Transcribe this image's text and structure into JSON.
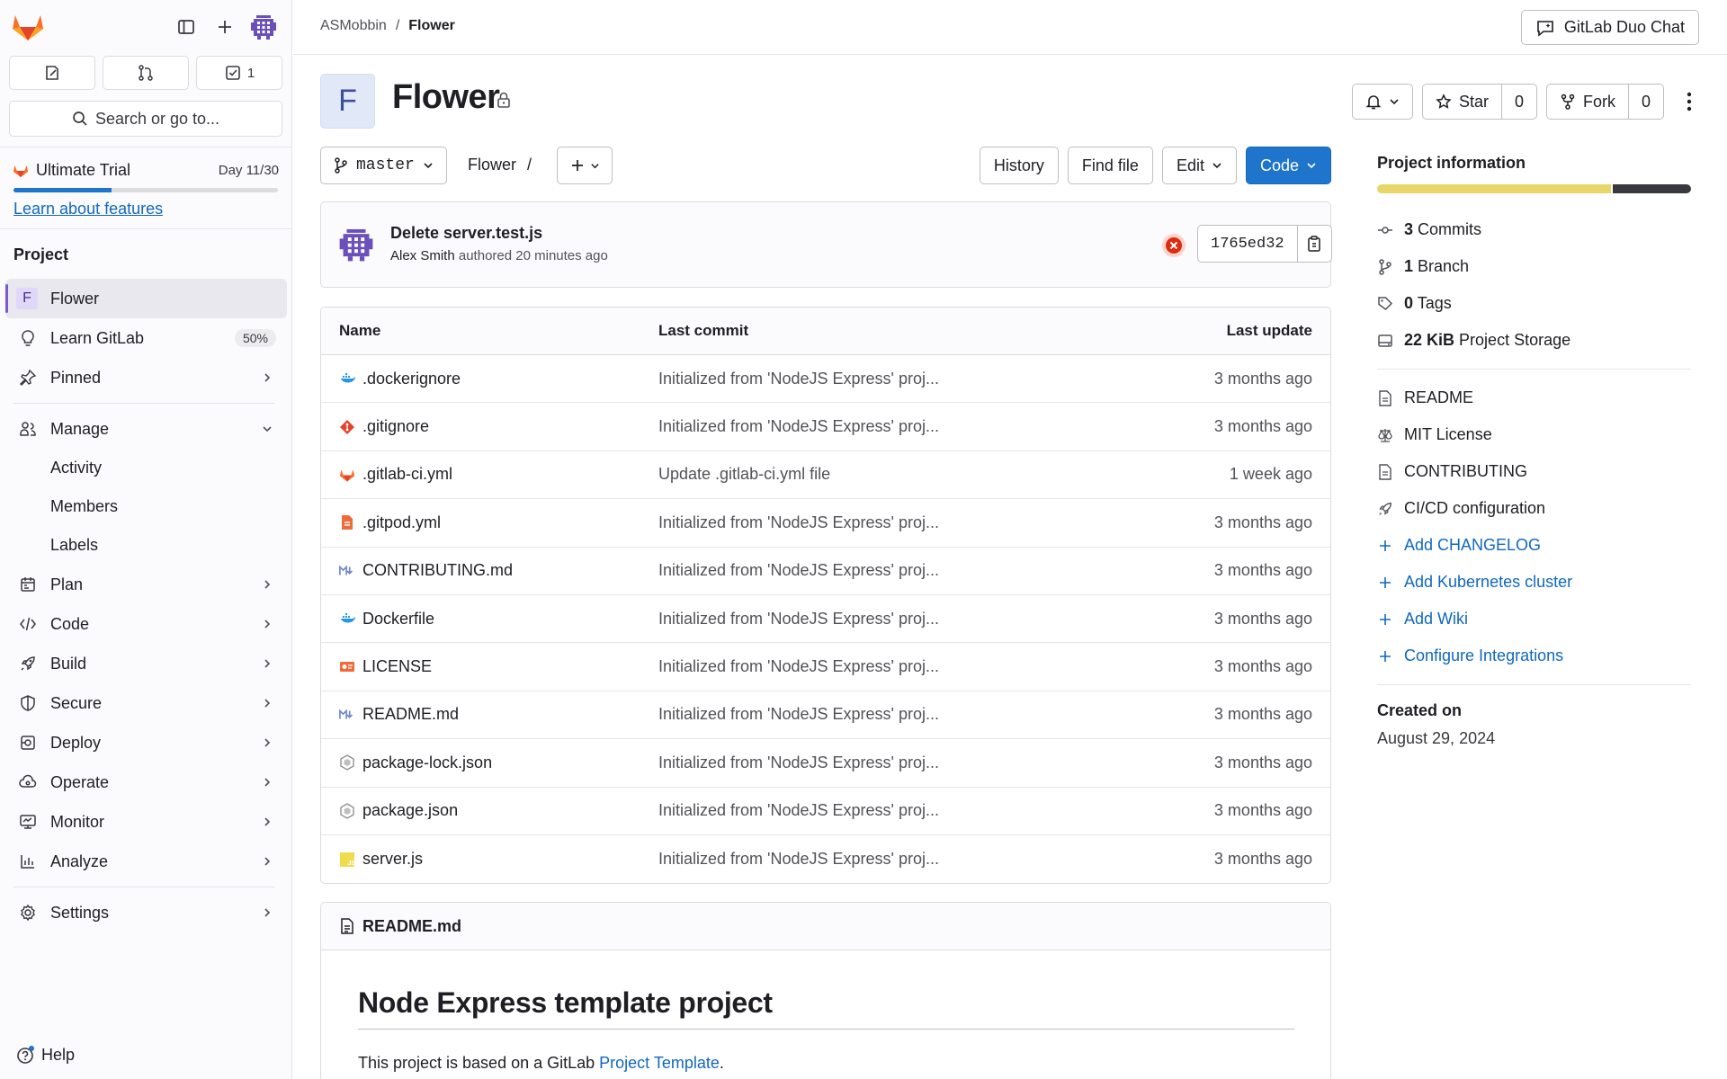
{
  "sidebar": {
    "todo_count": "1",
    "search_label": "Search or go to...",
    "trial": {
      "title": "Ultimate Trial",
      "day": "Day 11/30",
      "progress": 0.37,
      "link": "Learn about features"
    },
    "section": "Project",
    "project_letter": "F",
    "items": {
      "flower": "Flower",
      "learn": "Learn GitLab",
      "learn_badge": "50%",
      "pinned": "Pinned",
      "manage": "Manage",
      "activity": "Activity",
      "members": "Members",
      "labels": "Labels",
      "plan": "Plan",
      "code": "Code",
      "build": "Build",
      "secure": "Secure",
      "deploy": "Deploy",
      "operate": "Operate",
      "monitor": "Monitor",
      "analyze": "Analyze",
      "settings": "Settings"
    },
    "help": "Help"
  },
  "topbar": {
    "breadcrumb": {
      "group": "ASMobbin",
      "sep": "/",
      "project": "Flower"
    },
    "duo_label": "GitLab Duo Chat"
  },
  "project": {
    "letter": "F",
    "title": "Flower",
    "star_label": "Star",
    "star_count": "0",
    "fork_label": "Fork",
    "fork_count": "0"
  },
  "toolbar": {
    "branch": "master",
    "path": "Flower",
    "path_sep": "/",
    "history": "History",
    "find_file": "Find file",
    "edit": "Edit",
    "code": "Code"
  },
  "commit": {
    "title": "Delete server.test.js",
    "author": "Alex Smith",
    "authored": "authored",
    "time": "20 minutes ago",
    "sha": "1765ed32"
  },
  "files": {
    "headers": {
      "name": "Name",
      "last_commit": "Last commit",
      "last_update": "Last update"
    },
    "rows": [
      {
        "name": ".dockerignore",
        "commit": "Initialized from 'NodeJS Express' proj...",
        "update": "3 months ago",
        "icon": "docker"
      },
      {
        "name": ".gitignore",
        "commit": "Initialized from 'NodeJS Express' proj...",
        "update": "3 months ago",
        "icon": "git"
      },
      {
        "name": ".gitlab-ci.yml",
        "commit": "Update .gitlab-ci.yml file",
        "update": "1 week ago",
        "icon": "gitlab"
      },
      {
        "name": ".gitpod.yml",
        "commit": "Initialized from 'NodeJS Express' proj...",
        "update": "3 months ago",
        "icon": "gitpod"
      },
      {
        "name": "CONTRIBUTING.md",
        "commit": "Initialized from 'NodeJS Express' proj...",
        "update": "3 months ago",
        "icon": "markdown"
      },
      {
        "name": "Dockerfile",
        "commit": "Initialized from 'NodeJS Express' proj...",
        "update": "3 months ago",
        "icon": "docker"
      },
      {
        "name": "LICENSE",
        "commit": "Initialized from 'NodeJS Express' proj...",
        "update": "3 months ago",
        "icon": "license"
      },
      {
        "name": "README.md",
        "commit": "Initialized from 'NodeJS Express' proj...",
        "update": "3 months ago",
        "icon": "markdown"
      },
      {
        "name": "package-lock.json",
        "commit": "Initialized from 'NodeJS Express' proj...",
        "update": "3 months ago",
        "icon": "node"
      },
      {
        "name": "package.json",
        "commit": "Initialized from 'NodeJS Express' proj...",
        "update": "3 months ago",
        "icon": "node"
      },
      {
        "name": "server.js",
        "commit": "Initialized from 'NodeJS Express' proj...",
        "update": "3 months ago",
        "icon": "js"
      }
    ]
  },
  "readme": {
    "filename": "README.md",
    "heading": "Node Express template project",
    "text_before": "This project is based on a GitLab ",
    "link": "Project Template",
    "text_after": "."
  },
  "info": {
    "title": "Project information",
    "usage": [
      0.75,
      0.25
    ],
    "commits_count": "3",
    "commits": "Commits",
    "branch_count": "1",
    "branch": "Branch",
    "tags_count": "0",
    "tags": "Tags",
    "storage_size": "22 KiB",
    "storage": "Project Storage",
    "readme": "README",
    "license": "MIT License",
    "contributing": "CONTRIBUTING",
    "cicd": "CI/CD configuration",
    "add_changelog": "Add CHANGELOG",
    "add_k8s": "Add Kubernetes cluster",
    "add_wiki": "Add Wiki",
    "configure": "Configure Integrations",
    "created_label": "Created on",
    "created_date": "August 29, 2024"
  },
  "colors": {
    "primary": "#1f75cb",
    "link": "#1068bf",
    "tanuki": "#e24329",
    "accent": "#7b58cf"
  }
}
